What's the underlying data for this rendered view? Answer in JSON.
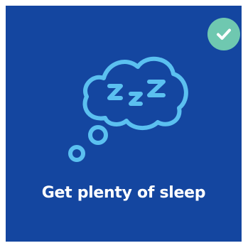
{
  "card": {
    "title": "Get plenty of sleep",
    "selected": true,
    "background_color": "#1446a0",
    "icon": "sleep-thought-bubble-icon",
    "icon_color": "#5bc0f0"
  },
  "badge": {
    "icon": "checkmark-icon",
    "color": "#6fc8b0"
  }
}
